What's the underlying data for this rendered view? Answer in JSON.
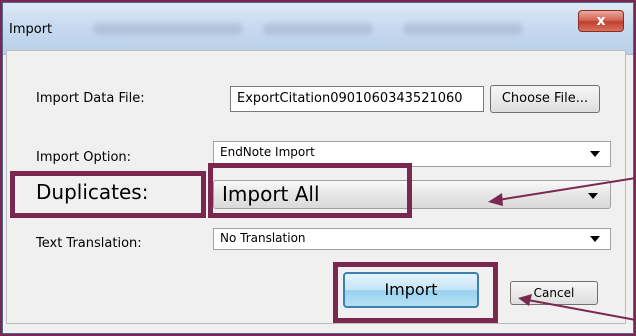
{
  "window": {
    "title": "Import",
    "close_glyph": "x"
  },
  "form": {
    "import_data_file": {
      "label": "Import Data File:",
      "value": "ExportCitation0901060343521060",
      "choose_label": "Choose File..."
    },
    "import_option": {
      "label": "Import Option:",
      "selected": "EndNote Import"
    },
    "duplicates": {
      "label": "Duplicates:",
      "selected": "Import All"
    },
    "text_translation": {
      "label": "Text Translation:",
      "selected": "No Translation"
    }
  },
  "buttons": {
    "import_label": "Import",
    "cancel_label": "Cancel"
  },
  "annotation": {
    "highlight_color": "#7a2850"
  }
}
